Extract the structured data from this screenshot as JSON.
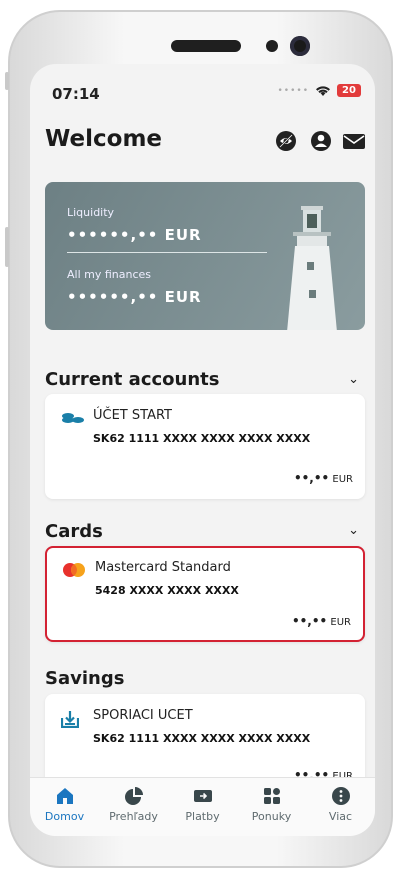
{
  "status": {
    "time": "07:14",
    "battery": "20"
  },
  "header": {
    "title": "Welcome"
  },
  "hero": {
    "liquidity_label": "Liquidity",
    "liquidity_value": "••••••,•• EUR",
    "finances_label": "All my finances",
    "finances_value": "••••••,•• EUR"
  },
  "accounts": {
    "title": "Current accounts",
    "item": {
      "name": "ÚČET START",
      "number": "SK62 1111 XXXX XXXX XXXX XXXX",
      "balance_dots": "••,••",
      "currency": "EUR"
    }
  },
  "cards": {
    "title": "Cards",
    "item": {
      "name": "Mastercard Standard",
      "number": "5428 XXXX XXXX XXXX",
      "balance_dots": "••,••",
      "currency": "EUR"
    }
  },
  "savings": {
    "title": "Savings",
    "item": {
      "name": "SPORIACI UCET",
      "number": "SK62 1111 XXXX XXXX XXXX XXXX",
      "balance_dots": "••,••",
      "currency": "EUR"
    }
  },
  "nav": {
    "items": [
      {
        "label": "Domov",
        "icon": "home-icon",
        "active": true
      },
      {
        "label": "Prehľady",
        "icon": "pie-chart-icon"
      },
      {
        "label": "Platby",
        "icon": "payment-icon"
      },
      {
        "label": "Ponuky",
        "icon": "offers-icon"
      },
      {
        "label": "Viac",
        "icon": "more-icon"
      }
    ]
  },
  "colors": {
    "accent": "#1b76c0",
    "highlight": "#d32233",
    "hero": "#7a8c90",
    "savings_icon": "#1a7fa8"
  }
}
